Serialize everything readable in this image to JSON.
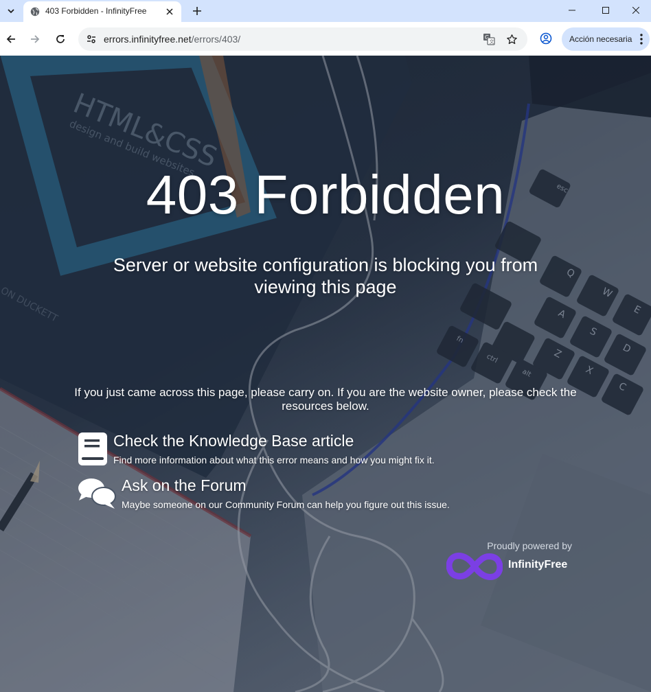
{
  "browser": {
    "tab": {
      "title": "403 Forbidden - InfinityFree"
    },
    "address": {
      "host": "errors.infinityfree.net",
      "path": "/errors/403/"
    },
    "action_button": {
      "label": "Acción necesaria"
    },
    "icons": {
      "tab_search": "chevron-down-icon",
      "favicon": "globe-icon",
      "close": "close-icon",
      "new_tab": "plus-icon",
      "back": "back-arrow-icon",
      "forward": "forward-arrow-icon",
      "reload": "reload-icon",
      "site_info": "tune-icon",
      "translate": "translate-icon",
      "bookmark": "star-icon",
      "profile": "profile-icon",
      "menu": "kebab-menu-icon"
    }
  },
  "page": {
    "title": "403 Forbidden",
    "subtitle": "Server or website configuration is blocking you from viewing this page",
    "intro": "If you just came across this page, please carry on. If you are the website owner, please check the resources below.",
    "resources": [
      {
        "title": "Check the Knowledge Base article",
        "description": "Find more information about what this error means and how you might fix it.",
        "icon": "book-icon"
      },
      {
        "title": "Ask on the Forum",
        "description": "Maybe someone on our Community Forum can help you figure out this issue.",
        "icon": "chat-bubbles-icon"
      }
    ],
    "footer": {
      "powered_by": "Proudly powered by",
      "brand": "InfinityFree",
      "brand_color": "#7b3fe4"
    },
    "background_art": {
      "book_title": "HTML&CSS",
      "book_subtitle": "design and build websites",
      "book_author": "ON DUCKETT",
      "keys": [
        "esc",
        "Q",
        "W",
        "E",
        "A",
        "S",
        "D",
        "Z",
        "X",
        "C",
        "fn",
        "ctrl",
        "alt"
      ]
    }
  }
}
